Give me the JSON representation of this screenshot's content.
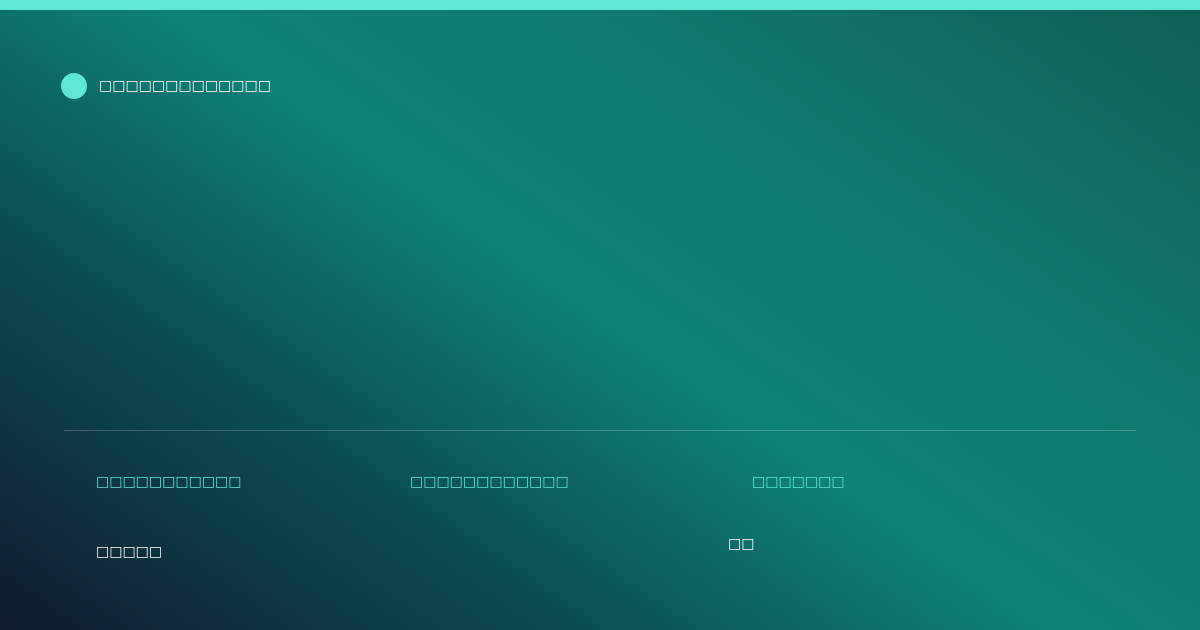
{
  "brand": {
    "icon": "circle-dot-icon",
    "name": "□□□□□□□□□□□□□"
  },
  "stats": [
    {
      "label": "□□□□□□□□□□□",
      "value": "□□□□□"
    },
    {
      "label": "□□□□□□□□□□□□",
      "value": ""
    },
    {
      "label": "□□□□□□□",
      "value": "□□"
    }
  ],
  "colors": {
    "accent": "#5ee8d4",
    "background_start": "#0f1a2e",
    "background_mid": "#0d8277",
    "background_end": "#115e58"
  }
}
